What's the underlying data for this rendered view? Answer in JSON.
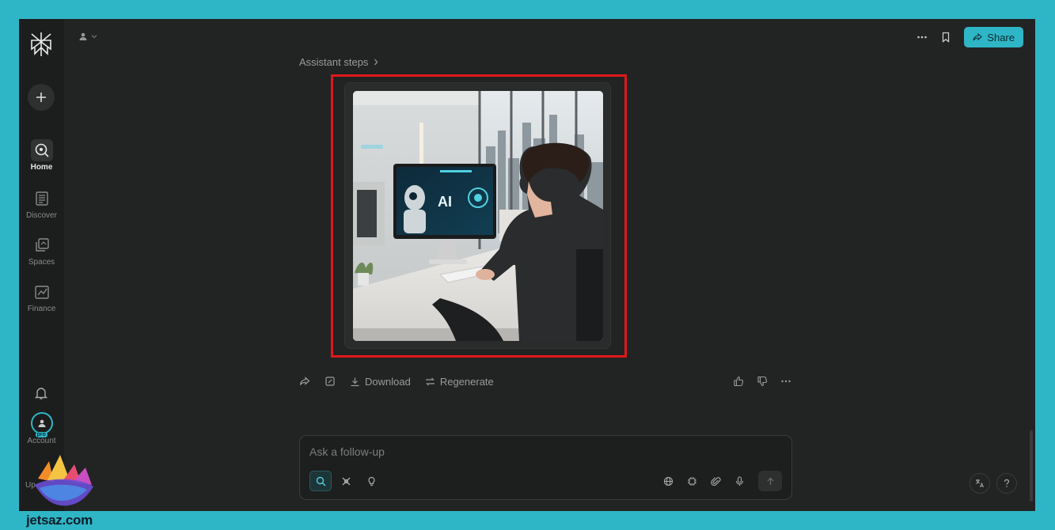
{
  "nav": {
    "items": [
      {
        "label": "Home",
        "active": true
      },
      {
        "label": "Discover"
      },
      {
        "label": "Spaces"
      },
      {
        "label": "Finance"
      }
    ],
    "account_label": "Account",
    "pro_badge": "pro",
    "upgrade_label": "Up"
  },
  "header": {
    "share_label": "Share"
  },
  "thread": {
    "steps_label": "Assistant steps",
    "image_screen_text": "AI",
    "actions": {
      "download_label": "Download",
      "regenerate_label": "Regenerate"
    }
  },
  "followup": {
    "placeholder": "Ask a follow-up"
  },
  "watermark": {
    "text": "jetsaz.com"
  },
  "colors": {
    "accent": "#2fb6c6",
    "highlight": "#e0181b",
    "background": "#222323"
  }
}
